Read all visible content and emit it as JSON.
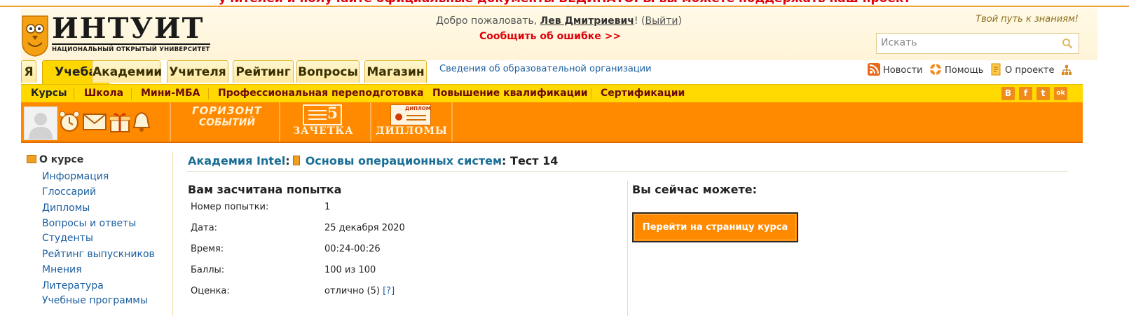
{
  "banner": {
    "text": "учителей и получайте официальные документы ВЕДИНАТОРЫ вы можете поддержать наш проект"
  },
  "header": {
    "logo_name": "ИНТУИТ",
    "logo_subtitle": "НАЦИОНАЛЬНЫЙ ОТКРЫТЫЙ УНИВЕРСИТЕТ",
    "welcome_prefix": "Добро пожаловать,",
    "user_name": "Лев Дмитриевич",
    "user_suffix": "!",
    "logout_open": "(",
    "logout_label": "Выйти",
    "logout_close": ")",
    "report_error": "Сообщить об ошибке >>",
    "tagline": "Твой путь к знаниям!",
    "search_placeholder": "Искать"
  },
  "tabs": [
    {
      "label": "Я"
    },
    {
      "label": "Учеба",
      "active": true
    },
    {
      "label": "Академии"
    },
    {
      "label": "Учителя"
    },
    {
      "label": "Рейтинг"
    },
    {
      "label": "Вопросы"
    },
    {
      "label": "Магазин"
    }
  ],
  "org_info_link": "Сведения об образовательной организации",
  "top_links": {
    "news": "Новости",
    "help": "Помощь",
    "about": "О проекте"
  },
  "subnav": [
    {
      "label": "Курсы"
    },
    {
      "label": "Школа"
    },
    {
      "label": "Мини-МБА"
    },
    {
      "label": "Профессиональная переподготовка"
    },
    {
      "label": "Повышение квалификации"
    },
    {
      "label": "Сертификации"
    }
  ],
  "social": [
    "В",
    "f",
    "t",
    "ok"
  ],
  "orangebar": {
    "horizon_top": "ГОРИЗОНТ",
    "horizon_bottom": "СОБЫТИЙ",
    "zachetka_mark": "5",
    "zachetka_label": "ЗАЧЕТКА",
    "diplomy_caption": "ДИПЛОМ",
    "diplomy_label": "ДИПЛОМЫ"
  },
  "sidebar": {
    "title": "О курсе",
    "items": [
      {
        "label": "Информация"
      },
      {
        "label": "Глоссарий"
      },
      {
        "label": "Дипломы"
      },
      {
        "label": "Вопросы и ответы"
      },
      {
        "label": "Студенты"
      },
      {
        "label": "Рейтинг выпускников"
      },
      {
        "label": "Мнения"
      },
      {
        "label": "Литература"
      },
      {
        "label": "Учебные программы"
      }
    ]
  },
  "breadcrumb": {
    "academy": "Академия Intel",
    "sep1": ":",
    "course": "Основы операционных систем",
    "sep2": ":",
    "test": "Тест 14"
  },
  "result": {
    "title": "Вам засчитана попытка",
    "rows": [
      {
        "label": "Номер попытки:",
        "value": "1"
      },
      {
        "label": "Дата:",
        "value": "25 декабря 2020"
      },
      {
        "label": "Время:",
        "value": "00:24-00:26"
      },
      {
        "label": "Баллы:",
        "value": "100 из 100"
      },
      {
        "label": "Оценка:",
        "value": "отлично (5)",
        "help": "[?]"
      }
    ]
  },
  "actions": {
    "title": "Вы сейчас можете:",
    "go_course_button": "Перейти на страницу курса"
  },
  "colors": {
    "orange": "#ff8a00",
    "yellow": "#ffd900",
    "link_blue": "#1b5fa0",
    "error_red": "#e0000a"
  }
}
